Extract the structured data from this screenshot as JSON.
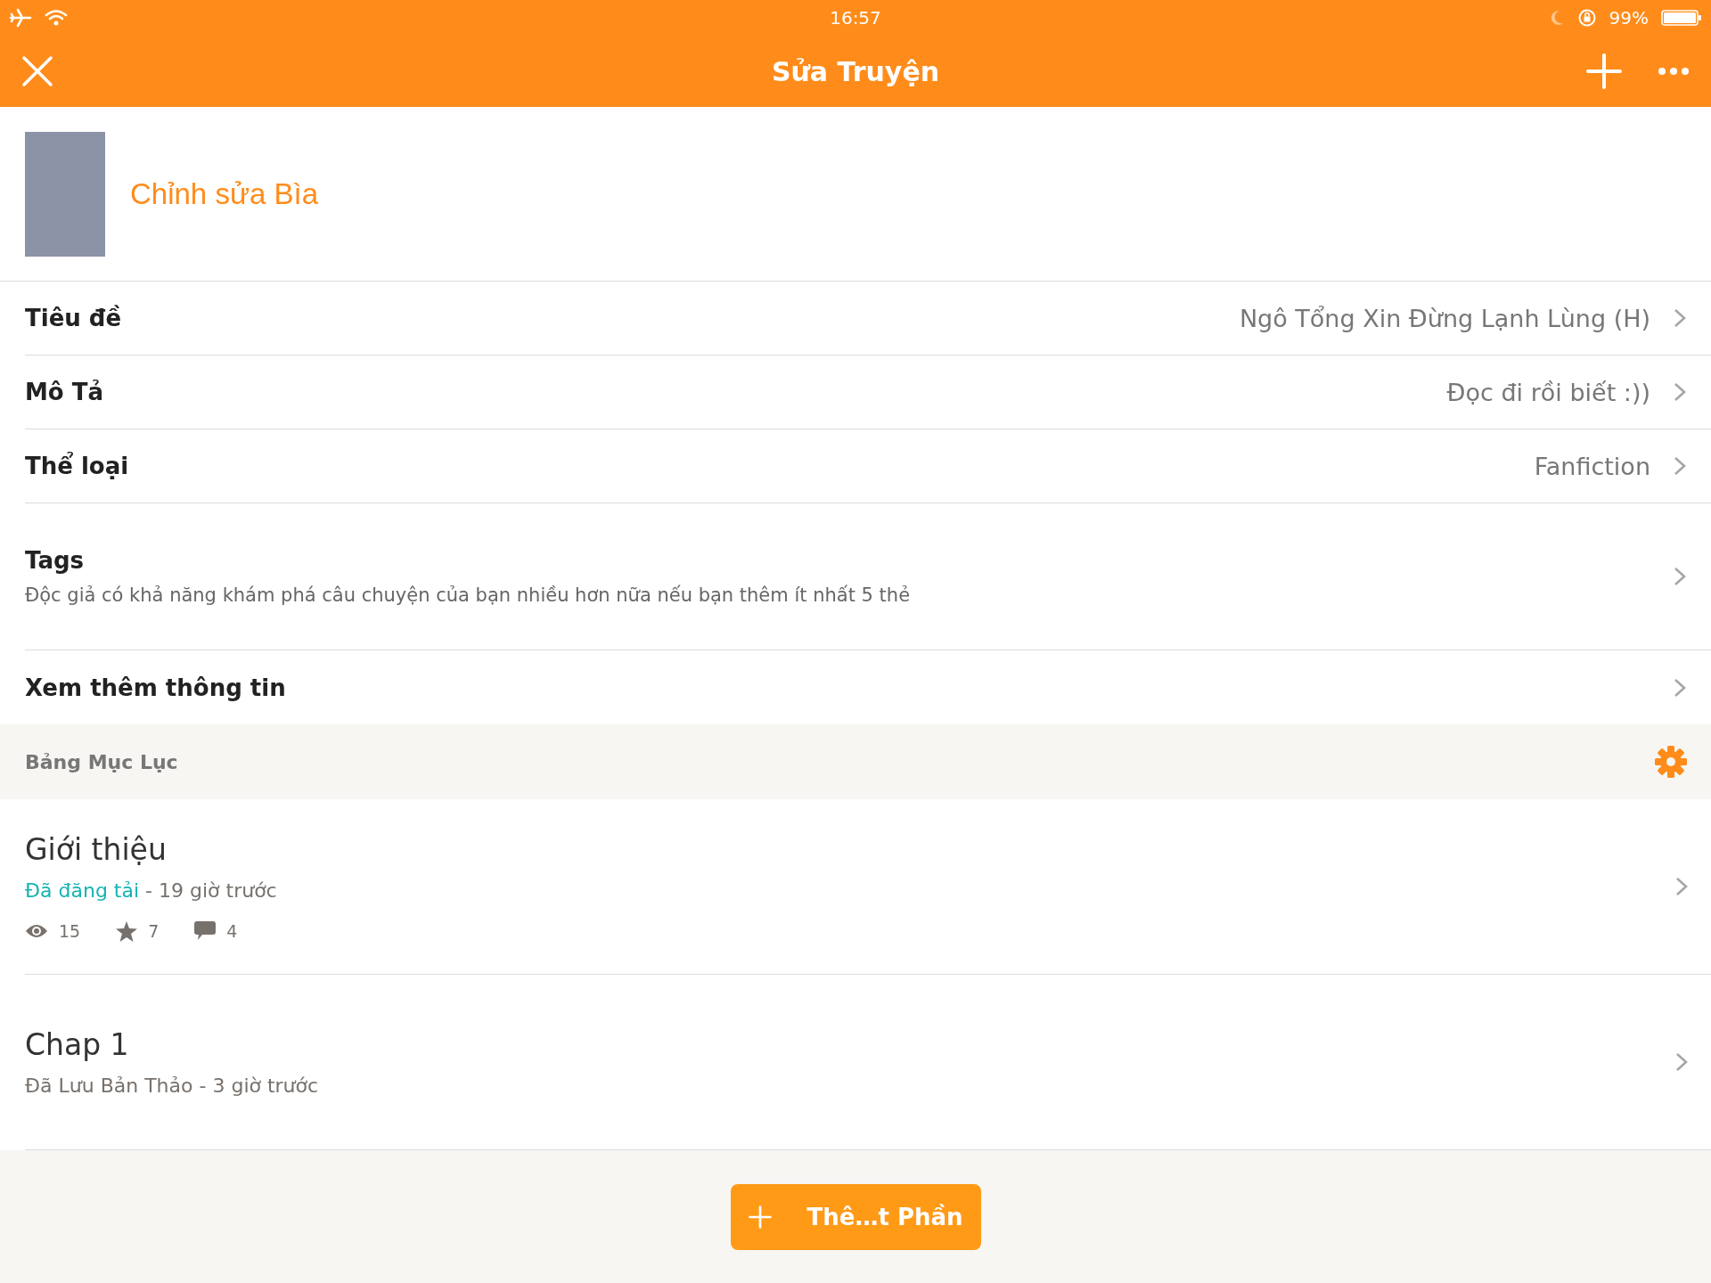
{
  "status_bar": {
    "time": "16:57",
    "battery": "99%"
  },
  "nav": {
    "title": "Sửa Truyện"
  },
  "cover": {
    "label": "Chỉnh sửa Bìa"
  },
  "fields": [
    {
      "label": "Tiêu đề",
      "value": "Ngô Tổng Xin Đừng Lạnh Lùng (H)"
    },
    {
      "label": "Mô Tả",
      "value": "Đọc đi rồi biết :))"
    },
    {
      "label": "Thể loại",
      "value": "Fanfiction"
    }
  ],
  "tags": {
    "label": "Tags",
    "hint": "Độc giả có khả năng khám phá câu chuyện của bạn nhiều hơn nữa nếu bạn thêm ít nhất 5 thẻ"
  },
  "more_info": {
    "label": "Xem thêm thông tin"
  },
  "toc": {
    "title": "Bảng Mục Lục"
  },
  "parts": [
    {
      "title": "Giới thiệu",
      "status": "Đã đăng tải",
      "kind": "published",
      "time": "- 19 giờ trước",
      "stats": [
        {
          "kind": "views",
          "value": "15"
        },
        {
          "kind": "votes",
          "value": "7"
        },
        {
          "kind": "comments",
          "value": "4"
        }
      ]
    },
    {
      "title": "Chap 1",
      "status": "Đã Lưu Bản Thảo",
      "kind": "draft",
      "time": "- 3 giờ trước"
    }
  ],
  "add_button": {
    "label": "Thê…t Phần"
  }
}
